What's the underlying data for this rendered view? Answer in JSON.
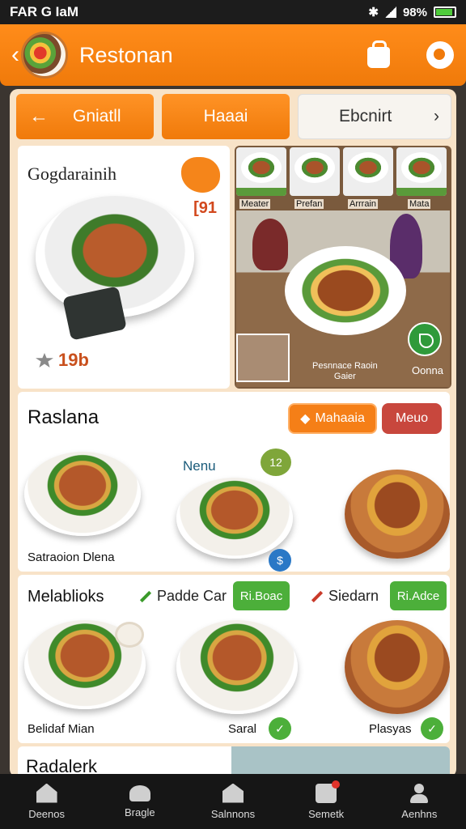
{
  "status_bar": {
    "carrier": "FAR G IaM",
    "battery_text": "98%"
  },
  "header": {
    "title": "Restonan"
  },
  "tabs": [
    {
      "label": "Gniatll"
    },
    {
      "label": "Haaai"
    },
    {
      "label": "Ebcnirt"
    }
  ],
  "feature": {
    "title": "Gogdarainih",
    "price": "[91",
    "rating": "19b"
  },
  "gallery": {
    "thumb_labels": [
      "Meater",
      "Prefan",
      "Arrrain",
      "Mata"
    ],
    "caption_line1": "Pesnnace Raoin",
    "caption_line2": "Gaier",
    "more_label": "Oonna"
  },
  "section1": {
    "title": "Raslana",
    "pill_orange": "Mahaaia",
    "pill_red": "Meuo",
    "menu_link": "Nenu",
    "badge_top": "12",
    "badge_bottom": "$",
    "dish_caption": "Satraoion Dlena"
  },
  "section2": {
    "title": "Melablioks",
    "link1": "Padde Car",
    "pill1": "Ri.Boac",
    "link2": "Siedarn",
    "pill2": "Ri.Adce",
    "caption1": "Belidaf Mian",
    "caption2": "Saral",
    "caption3": "Plasyas"
  },
  "section3": {
    "title": "Radalerk"
  },
  "nav": [
    {
      "label": "Deenos",
      "icon": "home-icon"
    },
    {
      "label": "Bragle",
      "icon": "cloche-icon"
    },
    {
      "label": "Salnnons",
      "icon": "store-icon"
    },
    {
      "label": "Semetk",
      "icon": "bag-icon"
    },
    {
      "label": "Aenhns",
      "icon": "user-icon"
    }
  ],
  "colors": {
    "accent": "#f07a0a",
    "nav_bg": "#161616",
    "green": "#4caf3a",
    "red": "#c8473d"
  }
}
